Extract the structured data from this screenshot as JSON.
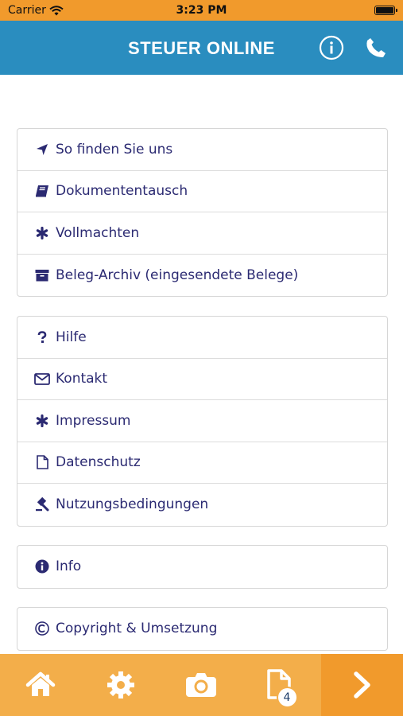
{
  "status_bar": {
    "carrier": "Carrier",
    "time": "3:23 PM"
  },
  "header": {
    "title": "STEUER ONLINE",
    "info_icon": "info-circle-icon",
    "phone_icon": "phone-icon"
  },
  "groups": [
    {
      "items": [
        {
          "label": "So finden Sie uns",
          "icon": "location-arrow-icon"
        },
        {
          "label": "Dokumententausch",
          "icon": "book-icon"
        },
        {
          "label": "Vollmachten",
          "icon": "asterisk-icon"
        },
        {
          "label": "Beleg-Archiv (eingesendete Belege)",
          "icon": "archive-icon"
        }
      ]
    },
    {
      "items": [
        {
          "label": "Hilfe",
          "icon": "question-icon"
        },
        {
          "label": "Kontakt",
          "icon": "envelope-icon"
        },
        {
          "label": "Impressum",
          "icon": "asterisk-icon"
        },
        {
          "label": "Datenschutz",
          "icon": "file-icon"
        },
        {
          "label": "Nutzungsbedingungen",
          "icon": "gavel-icon"
        }
      ]
    },
    {
      "items": [
        {
          "label": "Info",
          "icon": "info-icon"
        }
      ]
    },
    {
      "items": [
        {
          "label": "Copyright & Umsetzung",
          "icon": "copyright-icon"
        }
      ]
    }
  ],
  "tab_bar": {
    "items": [
      {
        "icon": "home-icon"
      },
      {
        "icon": "gear-icon"
      },
      {
        "icon": "camera-icon"
      },
      {
        "icon": "document-icon",
        "badge": "4"
      },
      {
        "icon": "chevron-right-icon"
      }
    ]
  },
  "colors": {
    "header": "#2a8dbf",
    "status_bar": "#f19a2c",
    "tab_bar": "#f3ae4a",
    "menu_text": "#2b2a72"
  }
}
